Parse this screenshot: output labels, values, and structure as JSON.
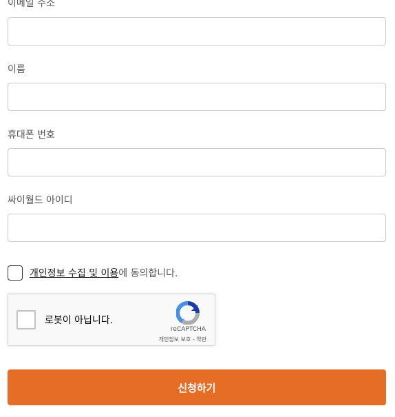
{
  "form": {
    "fields": [
      {
        "label": "이메일 주소",
        "value": "",
        "placeholder": ""
      },
      {
        "label": "이름",
        "value": "",
        "placeholder": ""
      },
      {
        "label": "휴대폰 번호",
        "value": "",
        "placeholder": ""
      },
      {
        "label": "싸이월드 아이디",
        "value": "",
        "placeholder": ""
      }
    ],
    "consent": {
      "link_text": "개인정보 수집 및 이용",
      "suffix_text": "에 동의합니다."
    },
    "recaptcha": {
      "label": "로봇이 아닙니다.",
      "brand": "reCAPTCHA",
      "privacy_link": "개인정보 보호",
      "separator": " - ",
      "terms_link": "약관",
      "icon": "recaptcha-logo-icon"
    },
    "submit_label": "신청하기"
  },
  "colors": {
    "accent": "#e56d26",
    "recaptcha_blue": "#1c3aa9",
    "recaptcha_lightblue": "#4a90e2",
    "recaptcha_gray": "#ababab"
  }
}
